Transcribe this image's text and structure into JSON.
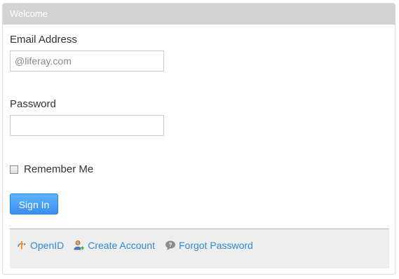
{
  "portlet": {
    "title": "Welcome"
  },
  "form": {
    "email_label": "Email Address",
    "email_placeholder": "@liferay.com",
    "email_value": "",
    "password_label": "Password",
    "password_value": "",
    "remember_label": "Remember Me",
    "remember_checked": false,
    "sign_in_label": "Sign In"
  },
  "navigation": {
    "links": [
      {
        "label": "OpenID",
        "icon": "openid-icon"
      },
      {
        "label": "Create Account",
        "icon": "add-user-icon"
      },
      {
        "label": "Forgot Password",
        "icon": "help-bubble-icon"
      }
    ]
  },
  "colors": {
    "header_bg": "#d3d3d3",
    "button_blue": "#3a8ff0",
    "link_blue": "#2a8bd6",
    "nav_bg": "#eeeeee"
  }
}
